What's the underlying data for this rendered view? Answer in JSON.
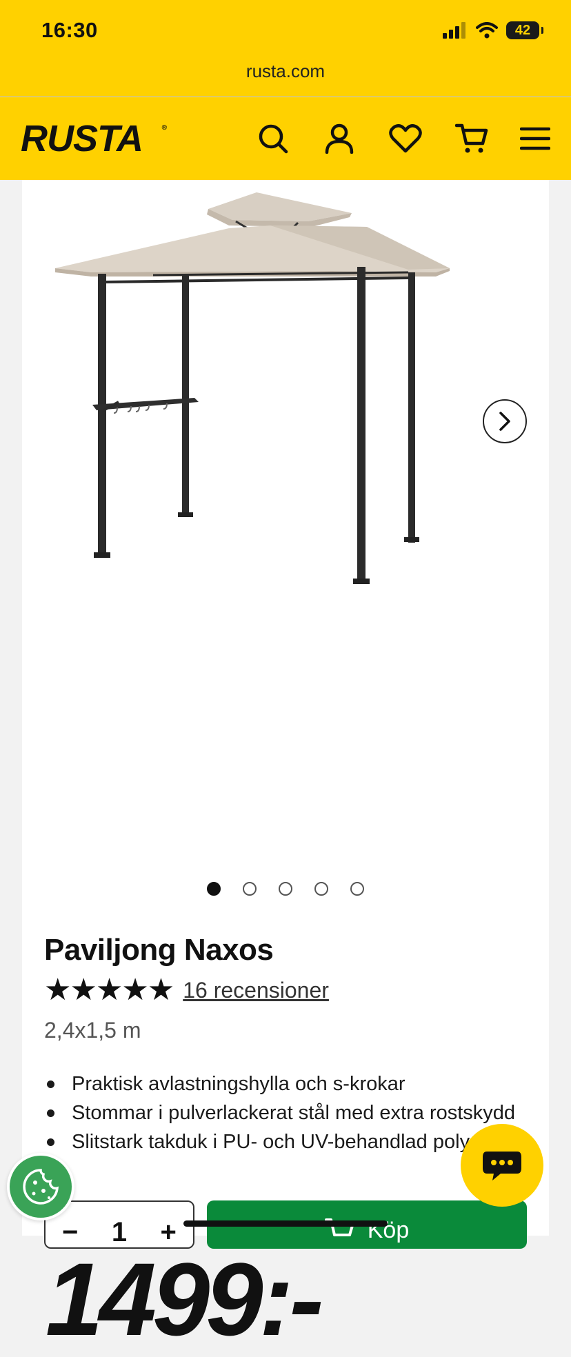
{
  "status_bar": {
    "time": "16:30",
    "battery": "42",
    "icons": [
      "signal-icon",
      "wifi-icon",
      "battery-icon"
    ]
  },
  "browser": {
    "url": "rusta.com"
  },
  "header": {
    "logo": "RUSTA",
    "logo_mark": "®",
    "icons": [
      "search-icon",
      "account-icon",
      "wishlist-heart-icon",
      "cart-icon",
      "menu-hamburger-icon"
    ],
    "brand_color": "#FFD100"
  },
  "gallery": {
    "image_alt": "gazebo-product-image",
    "total_images": 5,
    "active_index": 0,
    "next_icon": "chevron-right-icon"
  },
  "product": {
    "title": "Paviljong Naxos",
    "rating": 5,
    "stars": "★★★★★",
    "reviews_text": "16 recensioner",
    "size": "2,4x1,5 m",
    "features": [
      "Praktisk avlastningshylla och s-krokar",
      "Stommar i pulverlackerat stål med extra rostskydd",
      "Slitstark takduk i PU- och UV-behandlad polyester"
    ],
    "price": "1499:-"
  },
  "purchase": {
    "minus": "−",
    "quantity": "1",
    "plus": "+",
    "buy_label": "Köp",
    "buy_color": "#0a8a3a"
  },
  "floating": {
    "cookie_icon": "cookie-icon",
    "chat_icon": "chat-icon"
  }
}
